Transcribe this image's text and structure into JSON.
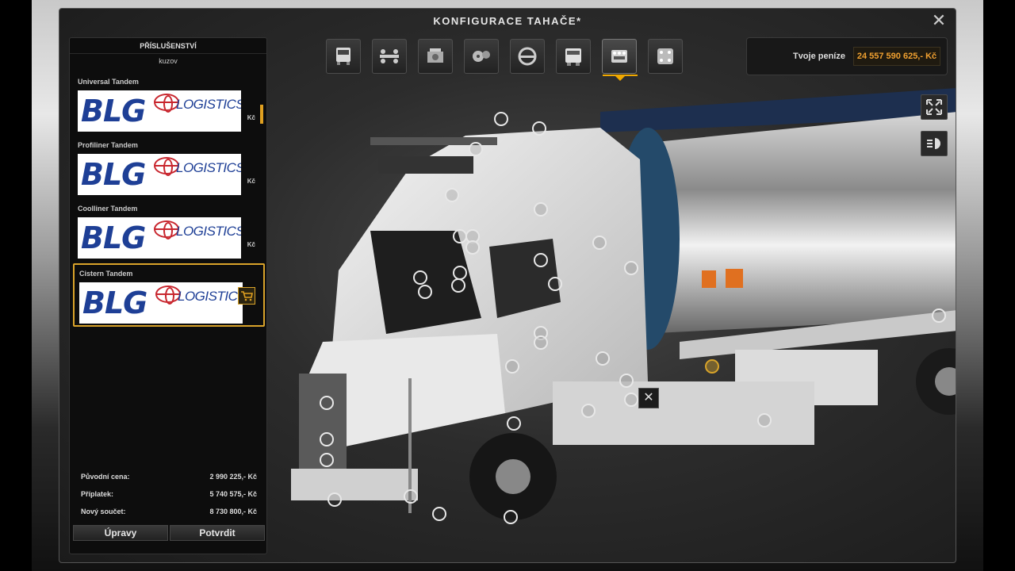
{
  "window": {
    "title": "KONFIGURACE TAHAČE*",
    "close_icon": "close-icon"
  },
  "toolbar": {
    "items": [
      {
        "icon": "cab-front-icon"
      },
      {
        "icon": "chassis-icon"
      },
      {
        "icon": "engine-icon"
      },
      {
        "icon": "transmission-icon"
      },
      {
        "icon": "cabin-interior-icon"
      },
      {
        "icon": "paint-icon"
      },
      {
        "icon": "accessories-icon",
        "active": true
      },
      {
        "icon": "interior-accessories-icon"
      }
    ],
    "accent_color": "#f0a800"
  },
  "money": {
    "label": "Tvoje peníze",
    "value": "24 557 590 625,- Kč",
    "value_color": "#f0a030"
  },
  "left_panel": {
    "header": "PŘÍSLUŠENSTVÍ",
    "category": "kuzov",
    "items": [
      {
        "name": "Universal Tandem",
        "logo_main": "BLG",
        "logo_sub": "LOGISTICS",
        "price_suffix": "Kč"
      },
      {
        "name": "Profiliner Tandem",
        "logo_main": "BLG",
        "logo_sub": "LOGISTICS",
        "price_suffix": "Kč"
      },
      {
        "name": "Coolliner Tandem",
        "logo_main": "BLG",
        "logo_sub": "LOGISTICS",
        "price_suffix": "Kč"
      },
      {
        "name": "Cistern Tandem",
        "logo_main": "BLG",
        "logo_sub": "LOGISTICS",
        "price_suffix": "Kč",
        "selected": true
      }
    ],
    "prices": [
      {
        "label": "Původní cena:",
        "value": "2 990 225,- Kč"
      },
      {
        "label": "Příplatek:",
        "value": "5 740 575,- Kč"
      },
      {
        "label": "Nový součet:",
        "value": "8 730 800,- Kč"
      }
    ],
    "buttons": {
      "edit": "Úpravy",
      "confirm": "Potvrdit"
    }
  },
  "side_tools": [
    {
      "icon": "fullscreen-icon"
    },
    {
      "icon": "headlight-icon"
    }
  ],
  "viewport": {
    "remove_label": "✕"
  }
}
